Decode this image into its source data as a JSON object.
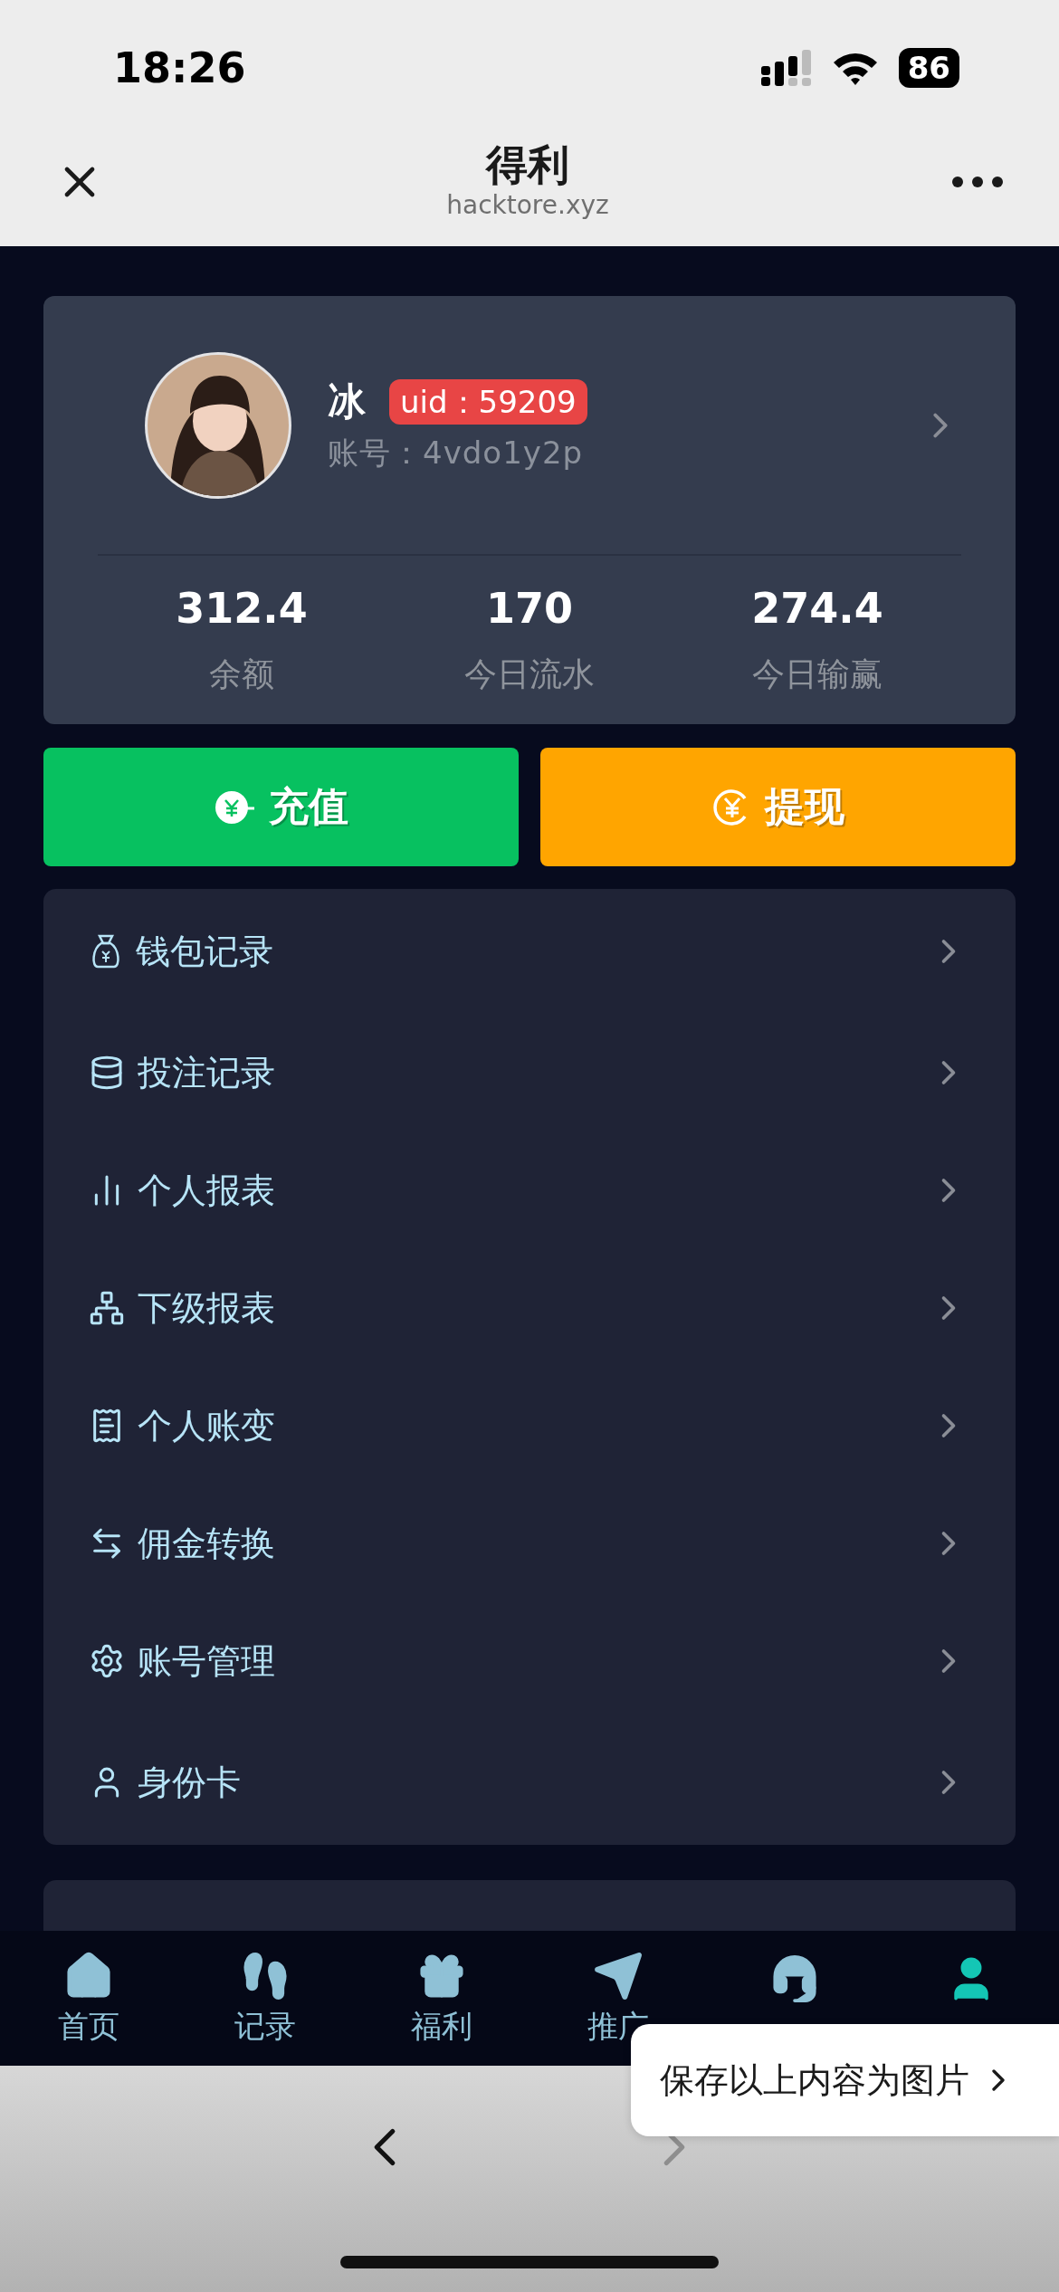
{
  "status_bar": {
    "time": "18:26",
    "battery": "86"
  },
  "header": {
    "title": "得利",
    "subtitle": "hacktore.xyz"
  },
  "profile": {
    "name": "冰",
    "uid_badge": "uid：59209",
    "account": "账号：4vdo1y2p",
    "stats": [
      {
        "value": "312.4",
        "label": "余额"
      },
      {
        "value": "170",
        "label": "今日流水"
      },
      {
        "value": "274.4",
        "label": "今日输赢"
      }
    ]
  },
  "actions": [
    {
      "label": "充值",
      "kind": "deposit"
    },
    {
      "label": "提现",
      "kind": "withdraw"
    }
  ],
  "menu": [
    {
      "label": "钱包记录"
    },
    {
      "label": "投注记录"
    },
    {
      "label": "个人报表"
    },
    {
      "label": "下级报表"
    },
    {
      "label": "个人账变"
    },
    {
      "label": "佣金转换"
    },
    {
      "label": "账号管理"
    },
    {
      "label": "身份卡"
    }
  ],
  "tab_bar": [
    {
      "label": "首页",
      "selected": false
    },
    {
      "label": "记录",
      "selected": false
    },
    {
      "label": "福利",
      "selected": false
    },
    {
      "label": "推广",
      "selected": false
    },
    {
      "selected": false
    },
    {
      "selected": true
    }
  ],
  "browser_bar": {
    "back": {
      "disabled": false
    },
    "forward": {
      "disabled": true
    }
  },
  "popup": {
    "label": "保存以上内容为图片"
  }
}
